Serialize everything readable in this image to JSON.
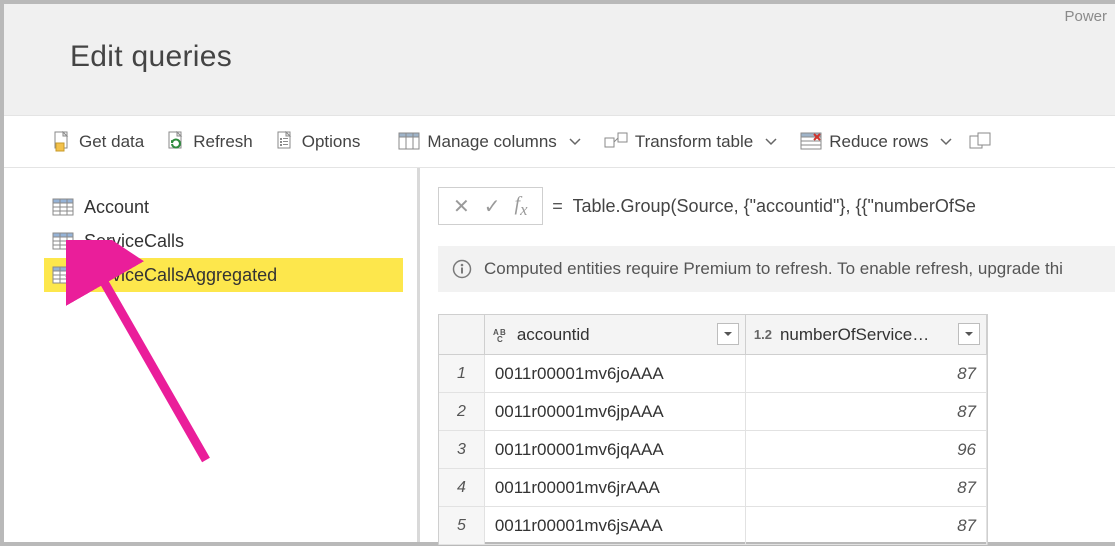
{
  "brand": "Power",
  "title": "Edit queries",
  "toolbar": {
    "get_data": "Get data",
    "refresh": "Refresh",
    "options": "Options",
    "manage_columns": "Manage columns",
    "transform_table": "Transform table",
    "reduce_rows": "Reduce rows"
  },
  "sidebar": {
    "items": [
      {
        "label": "Account",
        "selected": false
      },
      {
        "label": "ServiceCalls",
        "selected": false
      },
      {
        "label": "ServiceCallsAggregated",
        "selected": true
      }
    ]
  },
  "formula": {
    "eq": "=",
    "code": "Table.Group(Source, {\"accountid\"}, {{\"numberOfSe"
  },
  "info_banner": "Computed entities require Premium to refresh. To enable refresh, upgrade thi",
  "table": {
    "columns": [
      {
        "type_label": "A B C",
        "name": "accountid"
      },
      {
        "type_label": "1.2",
        "name": "numberOfServiceC..."
      }
    ],
    "rows": [
      {
        "n": "1",
        "accountid": "0011r00001mv6joAAA",
        "numberOfServiceC": "87"
      },
      {
        "n": "2",
        "accountid": "0011r00001mv6jpAAA",
        "numberOfServiceC": "87"
      },
      {
        "n": "3",
        "accountid": "0011r00001mv6jqAAA",
        "numberOfServiceC": "96"
      },
      {
        "n": "4",
        "accountid": "0011r00001mv6jrAAA",
        "numberOfServiceC": "87"
      },
      {
        "n": "5",
        "accountid": "0011r00001mv6jsAAA",
        "numberOfServiceC": "87"
      }
    ]
  }
}
